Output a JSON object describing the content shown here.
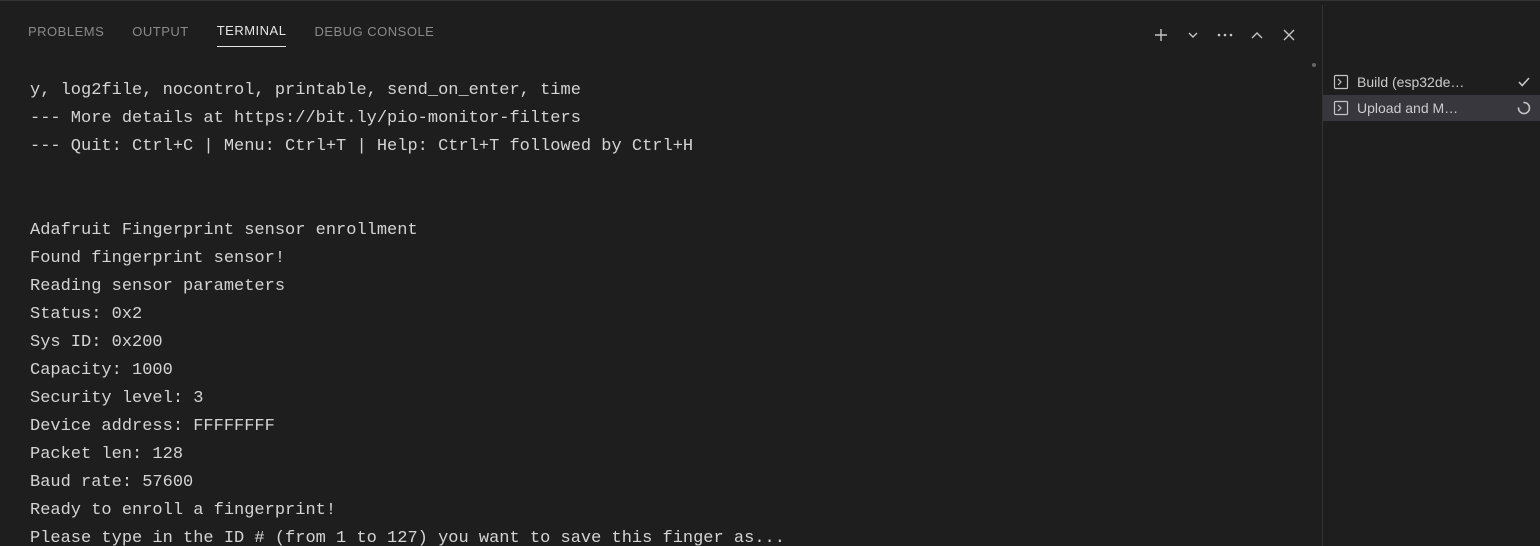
{
  "tabs": {
    "problems": "PROBLEMS",
    "output": "OUTPUT",
    "terminal": "TERMINAL",
    "debug_console": "DEBUG CONSOLE"
  },
  "terminal": {
    "lines": [
      "y, log2file, nocontrol, printable, send_on_enter, time",
      "--- More details at https://bit.ly/pio-monitor-filters",
      "--- Quit: Ctrl+C | Menu: Ctrl+T | Help: Ctrl+T followed by Ctrl+H",
      "",
      "",
      "Adafruit Fingerprint sensor enrollment",
      "Found fingerprint sensor!",
      "Reading sensor parameters",
      "Status: 0x2",
      "Sys ID: 0x200",
      "Capacity: 1000",
      "Security level: 3",
      "Device address: FFFFFFFF",
      "Packet len: 128",
      "Baud rate: 57600",
      "Ready to enroll a fingerprint!",
      "Please type in the ID # (from 1 to 127) you want to save this finger as..."
    ]
  },
  "tasks": [
    {
      "label": "Build (esp32de…",
      "status": "done"
    },
    {
      "label": "Upload and M…",
      "status": "running"
    }
  ]
}
